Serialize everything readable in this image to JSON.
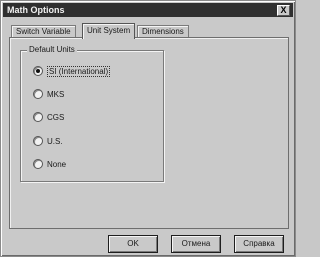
{
  "window": {
    "title": "Math Options",
    "close_label": "X"
  },
  "tabs": [
    {
      "label": "Switch Variable",
      "active": false
    },
    {
      "label": "Unit System",
      "active": true
    },
    {
      "label": "Dimensions",
      "active": false
    }
  ],
  "unit_system": {
    "group_label": "Default Units",
    "options": [
      {
        "label": "SI (International)",
        "checked": true
      },
      {
        "label": "MKS",
        "checked": false
      },
      {
        "label": "CGS",
        "checked": false
      },
      {
        "label": "U.S.",
        "checked": false
      },
      {
        "label": "None",
        "checked": false
      }
    ]
  },
  "buttons": {
    "ok": "OK",
    "cancel": "Отмена",
    "help": "Справка"
  }
}
